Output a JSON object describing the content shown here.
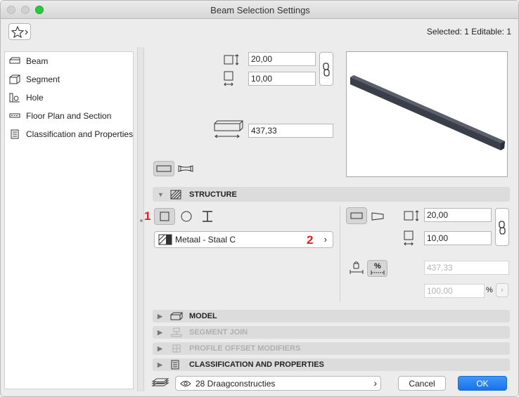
{
  "window": {
    "title": "Beam Selection Settings"
  },
  "header": {
    "selected_info": "Selected: 1 Editable: 1"
  },
  "sidebar": {
    "items": [
      {
        "label": "Beam",
        "icon": "beam-icon"
      },
      {
        "label": "Segment",
        "icon": "segment-icon"
      },
      {
        "label": "Hole",
        "icon": "hole-icon"
      },
      {
        "label": "Floor Plan and Section",
        "icon": "floor-plan-icon"
      },
      {
        "label": "Classification and Properties",
        "icon": "classification-icon"
      }
    ]
  },
  "geometry": {
    "height": "20,00",
    "width": "10,00",
    "length": "437,33"
  },
  "structure": {
    "title": "STRUCTURE",
    "marker_1": "1",
    "marker_2": "2",
    "material": "Metaal - Staal C",
    "seg_height": "20,00",
    "seg_width": "10,00",
    "taper_length": "437,33",
    "taper_percent": "100,00",
    "percent_label": "%",
    "percent_toggle": "%"
  },
  "sections": [
    {
      "label": "MODEL",
      "enabled": true
    },
    {
      "label": "SEGMENT JOIN",
      "enabled": false
    },
    {
      "label": "PROFILE OFFSET MODIFIERS",
      "enabled": false
    },
    {
      "label": "CLASSIFICATION AND PROPERTIES",
      "enabled": true
    }
  ],
  "footer": {
    "layer": "28 Draagconstructies",
    "cancel_label": "Cancel",
    "ok_label": "OK"
  },
  "colors": {
    "accent": "#1a73e8",
    "marker": "#e02020",
    "beam": "#3a3e48"
  }
}
